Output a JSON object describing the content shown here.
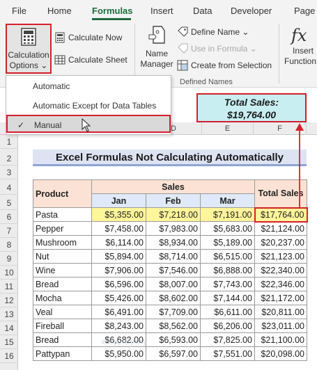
{
  "tabs": [
    {
      "label": "File",
      "active": false
    },
    {
      "label": "Home",
      "active": false
    },
    {
      "label": "Formulas",
      "active": true
    },
    {
      "label": "Insert",
      "active": false
    },
    {
      "label": "Data",
      "active": false
    },
    {
      "label": "Developer",
      "active": false
    },
    {
      "label": "Page",
      "active": false
    }
  ],
  "ribbon": {
    "calculation_options": {
      "line1": "Calculation",
      "line2": "Options ⌄"
    },
    "calculate_now": "Calculate Now",
    "calculate_sheet": "Calculate Sheet",
    "name_manager": {
      "line1": "Name",
      "line2": "Manager"
    },
    "define_name": "Define Name ⌄",
    "use_in_formula": "Use in Formula ⌄",
    "create_from_selection": "Create from Selection",
    "defined_names_group": "Defined Names",
    "insert_function": {
      "line1": "Insert",
      "line2": "Function"
    }
  },
  "menu": {
    "items": [
      {
        "label": "Automatic",
        "checked": false
      },
      {
        "label": "Automatic Except for Data Tables",
        "checked": false
      },
      {
        "label": "Manual",
        "checked": true
      }
    ]
  },
  "callout": {
    "line1": "Total Sales:",
    "line2": "$19,764.00"
  },
  "column_headers": [
    "D",
    "E",
    "F"
  ],
  "row_numbers": [
    "1",
    "2",
    "3",
    "4",
    "5",
    "6",
    "7",
    "8",
    "9",
    "10",
    "11",
    "12",
    "13",
    "14",
    "15",
    "16"
  ],
  "sheet": {
    "title": "Excel Formulas Not Calculating Automatically",
    "header_product": "Product",
    "header_sales": "Sales",
    "header_total": "Total Sales",
    "months": [
      "Jan",
      "Feb",
      "Mar"
    ],
    "rows": [
      {
        "product": "Pasta",
        "jan": "$5,355.00",
        "feb": "$7,218.00",
        "mar": "$7,191.00",
        "total": "$17,764.00"
      },
      {
        "product": "Pepper",
        "jan": "$7,458.00",
        "feb": "$7,983.00",
        "mar": "$5,683.00",
        "total": "$21,124.00"
      },
      {
        "product": "Mushroom",
        "jan": "$6,114.00",
        "feb": "$8,934.00",
        "mar": "$5,189.00",
        "total": "$20,237.00"
      },
      {
        "product": "Nut",
        "jan": "$5,894.00",
        "feb": "$8,714.00",
        "mar": "$6,515.00",
        "total": "$21,123.00"
      },
      {
        "product": "Wine",
        "jan": "$7,906.00",
        "feb": "$7,546.00",
        "mar": "$6,888.00",
        "total": "$22,340.00"
      },
      {
        "product": "Bread",
        "jan": "$6,596.00",
        "feb": "$8,007.00",
        "mar": "$7,743.00",
        "total": "$22,346.00"
      },
      {
        "product": "Mocha",
        "jan": "$5,426.00",
        "feb": "$8,602.00",
        "mar": "$7,144.00",
        "total": "$21,172.00"
      },
      {
        "product": "Veal",
        "jan": "$6,491.00",
        "feb": "$7,709.00",
        "mar": "$6,611.00",
        "total": "$20,811.00"
      },
      {
        "product": "Fireball",
        "jan": "$8,243.00",
        "feb": "$8,562.00",
        "mar": "$6,206.00",
        "total": "$23,011.00"
      },
      {
        "product": "Bread",
        "jan": "$6,682.00",
        "feb": "$6,593.00",
        "mar": "$7,825.00",
        "total": "$21,100.00"
      },
      {
        "product": "Pattypan",
        "jan": "$5,950.00",
        "feb": "$6,597.00",
        "mar": "$7,551.00",
        "total": "$20,098.00"
      }
    ]
  },
  "watermark": "exceldemy",
  "colors": {
    "accent": "#1e6b3c",
    "highlight": "#fff59a",
    "callout_bg": "#c8eef2",
    "red": "#d4202a"
  }
}
